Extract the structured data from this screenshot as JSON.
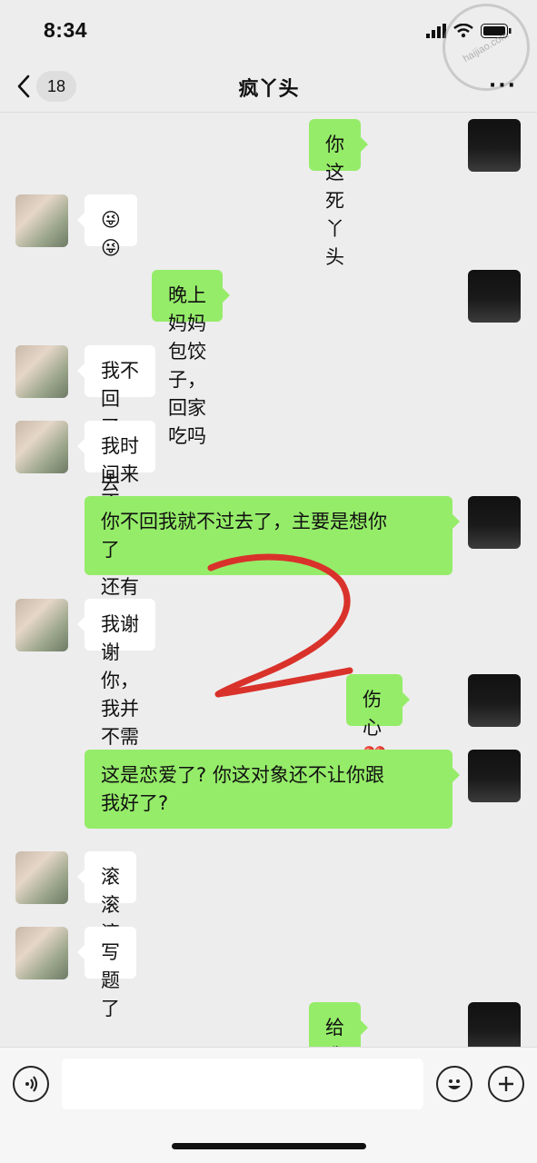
{
  "status_bar": {
    "time": "8:34",
    "watermark": "haijiao.com"
  },
  "header": {
    "back_badge": "18",
    "title": "疯丫头",
    "more": "···"
  },
  "messages": [
    {
      "from": "me",
      "text": "你这死丫头"
    },
    {
      "from": "her",
      "text": "😜😜"
    },
    {
      "from": "me",
      "text": "晚上妈妈包饺子，回家吃吗"
    },
    {
      "from": "her",
      "text": "我不回了，你过去吗?"
    },
    {
      "from": "her",
      "text": "我时间来不及，晚上还有晚自习"
    },
    {
      "from": "me",
      "line1": "你不回我就不过去了，主要是想你",
      "line2": "了"
    },
    {
      "from": "her",
      "text": "我谢谢你，我并不需要"
    },
    {
      "from": "me",
      "text": "伤心💔"
    },
    {
      "from": "me",
      "line1": "这是恋爱了? 你这对象还不让你跟",
      "line2": "我好了?"
    },
    {
      "from": "her",
      "text": "滚滚滚滚"
    },
    {
      "from": "her",
      "text": "写题了"
    },
    {
      "from": "me",
      "text": "给我看看你"
    }
  ],
  "input_bar": {
    "placeholder": ""
  },
  "icons": {
    "back": "chevron-left-icon",
    "voice": "voice-icon",
    "emoji": "emoji-icon",
    "plus": "plus-icon"
  },
  "colors": {
    "background": "#ededed",
    "bubble_me": "#95ec69",
    "bubble_her": "#ffffff",
    "annotation": "#d9322b"
  }
}
